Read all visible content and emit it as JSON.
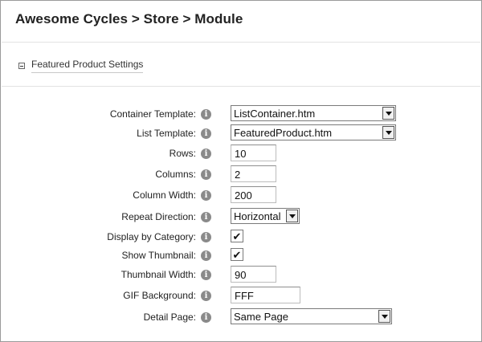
{
  "page": {
    "title": "Awesome Cycles > Store > Module"
  },
  "section": {
    "title": "Featured Product Settings"
  },
  "fields": {
    "container_template": {
      "label": "Container Template:",
      "value": "ListContainer.htm"
    },
    "list_template": {
      "label": "List Template:",
      "value": "FeaturedProduct.htm"
    },
    "rows": {
      "label": "Rows:",
      "value": "10"
    },
    "columns": {
      "label": "Columns:",
      "value": "2"
    },
    "column_width": {
      "label": "Column Width:",
      "value": "200"
    },
    "repeat_direction": {
      "label": "Repeat Direction:",
      "value": "Horizontal"
    },
    "display_by_category": {
      "label": "Display by Category:",
      "checked": true
    },
    "show_thumbnail": {
      "label": "Show Thumbnail:",
      "checked": true
    },
    "thumbnail_width": {
      "label": "Thumbnail Width:",
      "value": "90"
    },
    "gif_background": {
      "label": "GIF Background:",
      "value": "FFF"
    },
    "detail_page": {
      "label": "Detail Page:",
      "value": "Same Page"
    }
  },
  "icons": {
    "info_glyph": "i",
    "check_glyph": "✔"
  }
}
